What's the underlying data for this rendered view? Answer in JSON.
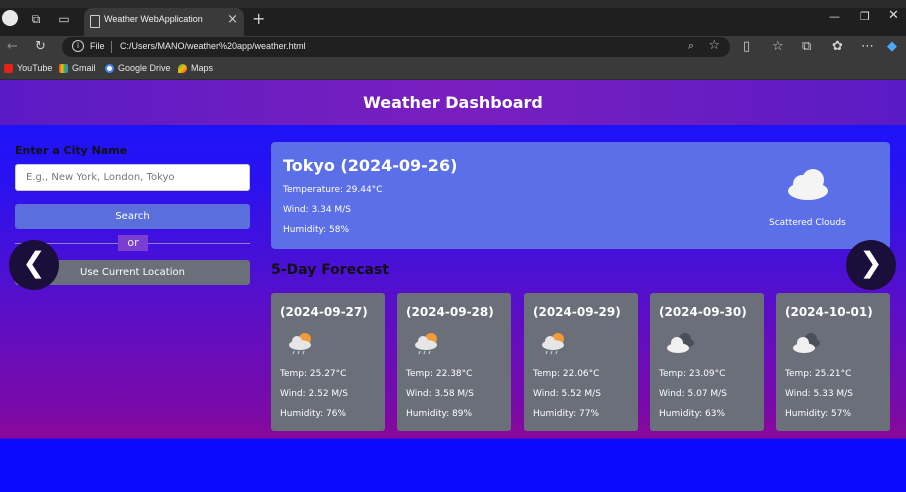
{
  "browser": {
    "tab_title": "Weather WebApplication",
    "address_scheme": "File",
    "address_url": "C:/Users/MANO/weather%20app/weather.html",
    "bookmarks": [
      "YouTube",
      "Gmail",
      "Google Drive",
      "Maps"
    ]
  },
  "app": {
    "title": "Weather Dashboard",
    "city_label": "Enter a City Name",
    "city_placeholder": "E.g., New York, London, Tokyo",
    "search_label": "Search",
    "or_label": "or",
    "location_label": "Use Current Location",
    "prev_glyph": "❮",
    "next_glyph": "❯"
  },
  "current": {
    "heading": "Tokyo (2024-09-26)",
    "temperature": "Temperature: 29.44°C",
    "wind": "Wind: 3.34 M/S",
    "humidity": "Humidity: 58%",
    "description": "Scattered Clouds",
    "icon": "scattered-clouds-icon"
  },
  "forecast": {
    "title": "5-Day Forecast",
    "days": [
      {
        "date": "(2024-09-27)",
        "temp": "Temp: 25.27°C",
        "wind": "Wind: 2.52 M/S",
        "humidity": "Humidity: 76%",
        "icon": "rain-sun-icon"
      },
      {
        "date": "(2024-09-28)",
        "temp": "Temp: 22.38°C",
        "wind": "Wind: 3.58 M/S",
        "humidity": "Humidity: 89%",
        "icon": "rain-sun-icon"
      },
      {
        "date": "(2024-09-29)",
        "temp": "Temp: 22.06°C",
        "wind": "Wind: 5.52 M/S",
        "humidity": "Humidity: 77%",
        "icon": "rain-sun-icon"
      },
      {
        "date": "(2024-09-30)",
        "temp": "Temp: 23.09°C",
        "wind": "Wind: 5.07 M/S",
        "humidity": "Humidity: 63%",
        "icon": "broken-clouds-icon"
      },
      {
        "date": "(2024-10-01)",
        "temp": "Temp: 25.21°C",
        "wind": "Wind: 5.33 M/S",
        "humidity": "Humidity: 57%",
        "icon": "broken-clouds-icon"
      }
    ]
  },
  "colors": {
    "header": "#6a1fc4",
    "current_card": "#5b6fe8",
    "forecast_card": "#6a6f7a",
    "search_button": "#5b6fdc"
  }
}
